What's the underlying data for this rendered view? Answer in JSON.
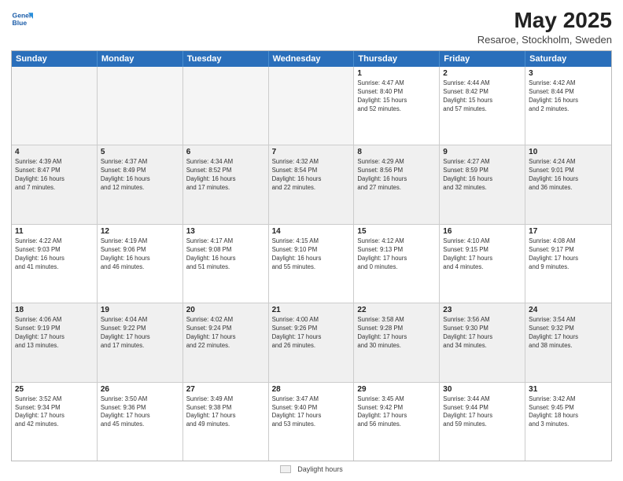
{
  "header": {
    "logo_line1": "General",
    "logo_line2": "Blue",
    "main_title": "May 2025",
    "subtitle": "Resaroe, Stockholm, Sweden"
  },
  "calendar": {
    "days_of_week": [
      "Sunday",
      "Monday",
      "Tuesday",
      "Wednesday",
      "Thursday",
      "Friday",
      "Saturday"
    ],
    "weeks": [
      [
        {
          "day": "",
          "info": "",
          "empty": true
        },
        {
          "day": "",
          "info": "",
          "empty": true
        },
        {
          "day": "",
          "info": "",
          "empty": true
        },
        {
          "day": "",
          "info": "",
          "empty": true
        },
        {
          "day": "1",
          "info": "Sunrise: 4:47 AM\nSunset: 8:40 PM\nDaylight: 15 hours\nand 52 minutes.",
          "empty": false
        },
        {
          "day": "2",
          "info": "Sunrise: 4:44 AM\nSunset: 8:42 PM\nDaylight: 15 hours\nand 57 minutes.",
          "empty": false
        },
        {
          "day": "3",
          "info": "Sunrise: 4:42 AM\nSunset: 8:44 PM\nDaylight: 16 hours\nand 2 minutes.",
          "empty": false
        }
      ],
      [
        {
          "day": "4",
          "info": "Sunrise: 4:39 AM\nSunset: 8:47 PM\nDaylight: 16 hours\nand 7 minutes.",
          "empty": false
        },
        {
          "day": "5",
          "info": "Sunrise: 4:37 AM\nSunset: 8:49 PM\nDaylight: 16 hours\nand 12 minutes.",
          "empty": false
        },
        {
          "day": "6",
          "info": "Sunrise: 4:34 AM\nSunset: 8:52 PM\nDaylight: 16 hours\nand 17 minutes.",
          "empty": false
        },
        {
          "day": "7",
          "info": "Sunrise: 4:32 AM\nSunset: 8:54 PM\nDaylight: 16 hours\nand 22 minutes.",
          "empty": false
        },
        {
          "day": "8",
          "info": "Sunrise: 4:29 AM\nSunset: 8:56 PM\nDaylight: 16 hours\nand 27 minutes.",
          "empty": false
        },
        {
          "day": "9",
          "info": "Sunrise: 4:27 AM\nSunset: 8:59 PM\nDaylight: 16 hours\nand 32 minutes.",
          "empty": false
        },
        {
          "day": "10",
          "info": "Sunrise: 4:24 AM\nSunset: 9:01 PM\nDaylight: 16 hours\nand 36 minutes.",
          "empty": false
        }
      ],
      [
        {
          "day": "11",
          "info": "Sunrise: 4:22 AM\nSunset: 9:03 PM\nDaylight: 16 hours\nand 41 minutes.",
          "empty": false
        },
        {
          "day": "12",
          "info": "Sunrise: 4:19 AM\nSunset: 9:06 PM\nDaylight: 16 hours\nand 46 minutes.",
          "empty": false
        },
        {
          "day": "13",
          "info": "Sunrise: 4:17 AM\nSunset: 9:08 PM\nDaylight: 16 hours\nand 51 minutes.",
          "empty": false
        },
        {
          "day": "14",
          "info": "Sunrise: 4:15 AM\nSunset: 9:10 PM\nDaylight: 16 hours\nand 55 minutes.",
          "empty": false
        },
        {
          "day": "15",
          "info": "Sunrise: 4:12 AM\nSunset: 9:13 PM\nDaylight: 17 hours\nand 0 minutes.",
          "empty": false
        },
        {
          "day": "16",
          "info": "Sunrise: 4:10 AM\nSunset: 9:15 PM\nDaylight: 17 hours\nand 4 minutes.",
          "empty": false
        },
        {
          "day": "17",
          "info": "Sunrise: 4:08 AM\nSunset: 9:17 PM\nDaylight: 17 hours\nand 9 minutes.",
          "empty": false
        }
      ],
      [
        {
          "day": "18",
          "info": "Sunrise: 4:06 AM\nSunset: 9:19 PM\nDaylight: 17 hours\nand 13 minutes.",
          "empty": false
        },
        {
          "day": "19",
          "info": "Sunrise: 4:04 AM\nSunset: 9:22 PM\nDaylight: 17 hours\nand 17 minutes.",
          "empty": false
        },
        {
          "day": "20",
          "info": "Sunrise: 4:02 AM\nSunset: 9:24 PM\nDaylight: 17 hours\nand 22 minutes.",
          "empty": false
        },
        {
          "day": "21",
          "info": "Sunrise: 4:00 AM\nSunset: 9:26 PM\nDaylight: 17 hours\nand 26 minutes.",
          "empty": false
        },
        {
          "day": "22",
          "info": "Sunrise: 3:58 AM\nSunset: 9:28 PM\nDaylight: 17 hours\nand 30 minutes.",
          "empty": false
        },
        {
          "day": "23",
          "info": "Sunrise: 3:56 AM\nSunset: 9:30 PM\nDaylight: 17 hours\nand 34 minutes.",
          "empty": false
        },
        {
          "day": "24",
          "info": "Sunrise: 3:54 AM\nSunset: 9:32 PM\nDaylight: 17 hours\nand 38 minutes.",
          "empty": false
        }
      ],
      [
        {
          "day": "25",
          "info": "Sunrise: 3:52 AM\nSunset: 9:34 PM\nDaylight: 17 hours\nand 42 minutes.",
          "empty": false
        },
        {
          "day": "26",
          "info": "Sunrise: 3:50 AM\nSunset: 9:36 PM\nDaylight: 17 hours\nand 45 minutes.",
          "empty": false
        },
        {
          "day": "27",
          "info": "Sunrise: 3:49 AM\nSunset: 9:38 PM\nDaylight: 17 hours\nand 49 minutes.",
          "empty": false
        },
        {
          "day": "28",
          "info": "Sunrise: 3:47 AM\nSunset: 9:40 PM\nDaylight: 17 hours\nand 53 minutes.",
          "empty": false
        },
        {
          "day": "29",
          "info": "Sunrise: 3:45 AM\nSunset: 9:42 PM\nDaylight: 17 hours\nand 56 minutes.",
          "empty": false
        },
        {
          "day": "30",
          "info": "Sunrise: 3:44 AM\nSunset: 9:44 PM\nDaylight: 17 hours\nand 59 minutes.",
          "empty": false
        },
        {
          "day": "31",
          "info": "Sunrise: 3:42 AM\nSunset: 9:45 PM\nDaylight: 18 hours\nand 3 minutes.",
          "empty": false
        }
      ]
    ]
  },
  "footer": {
    "legend_label": "Daylight hours"
  }
}
